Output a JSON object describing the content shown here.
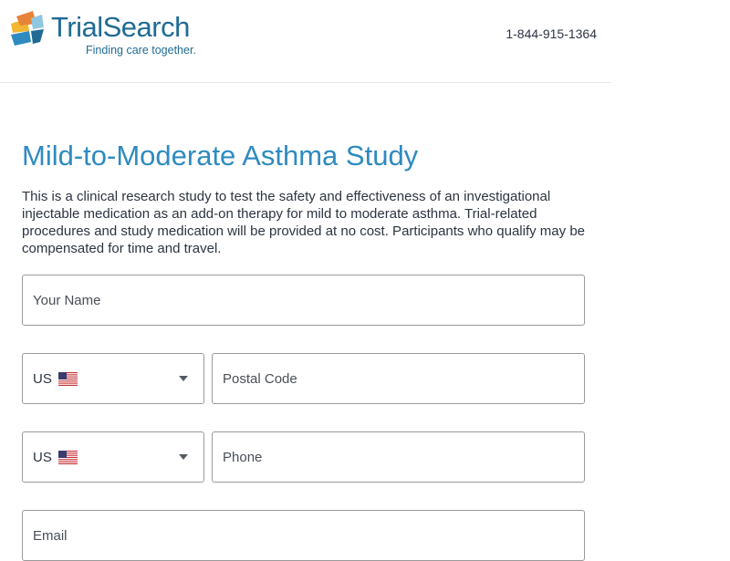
{
  "brand": {
    "name": "TrialSearch",
    "tagline": "Finding care together."
  },
  "header": {
    "phone": "1-844-915-1364"
  },
  "study": {
    "title": "Mild-to-Moderate Asthma Study",
    "description": "This is a clinical research study to test the safety and effectiveness of an investigational injectable medication as an add-on therapy for mild to moderate asthma.  Trial-related procedures and study medication will be provided at no cost.  Participants who qualify may be compensated for time and travel."
  },
  "form": {
    "name_placeholder": "Your Name",
    "postal_country": {
      "code": "US",
      "flag": "us-flag-icon"
    },
    "postal_placeholder": "Postal Code",
    "phone_country": {
      "code": "US",
      "flag": "us-flag-icon"
    },
    "phone_placeholder": "Phone",
    "email_placeholder": "Email"
  },
  "colors": {
    "accent": "#2e8bc0",
    "brand": "#1f6b94",
    "text": "#2c3440"
  }
}
